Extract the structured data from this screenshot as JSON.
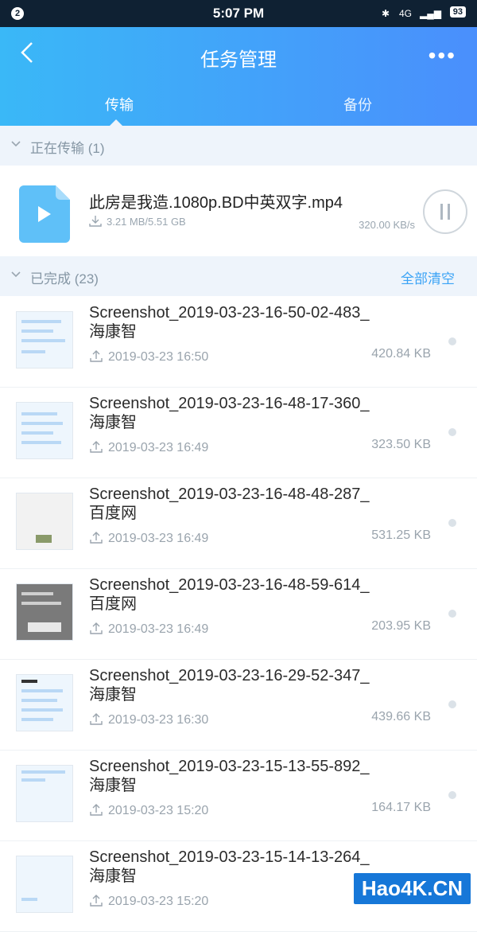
{
  "status": {
    "badge": "2",
    "time": "5:07 PM",
    "network": "4G",
    "battery": "93"
  },
  "header": {
    "title": "任务管理",
    "more_label": "•••"
  },
  "tabs": [
    {
      "label": "传输",
      "active": true
    },
    {
      "label": "备份",
      "active": false
    }
  ],
  "in_progress": {
    "label": "正在传输 (1)",
    "item": {
      "name": "此房是我造.1080p.BD中英双字.mp4",
      "progress": "3.21 MB/5.51 GB",
      "speed": "320.00 KB/s"
    }
  },
  "completed": {
    "label": "已完成 (23)",
    "clear_all": "全部清空",
    "items": [
      {
        "name": "Screenshot_2019-03-23-16-50-02-483_海康智",
        "date": "2019-03-23 16:50",
        "size": "420.84 KB"
      },
      {
        "name": "Screenshot_2019-03-23-16-48-17-360_海康智",
        "date": "2019-03-23 16:49",
        "size": "323.50 KB"
      },
      {
        "name": "Screenshot_2019-03-23-16-48-48-287_百度网",
        "date": "2019-03-23 16:49",
        "size": "531.25 KB"
      },
      {
        "name": "Screenshot_2019-03-23-16-48-59-614_百度网",
        "date": "2019-03-23 16:49",
        "size": "203.95 KB"
      },
      {
        "name": "Screenshot_2019-03-23-16-29-52-347_海康智",
        "date": "2019-03-23 16:30",
        "size": "439.66 KB"
      },
      {
        "name": "Screenshot_2019-03-23-15-13-55-892_海康智",
        "date": "2019-03-23 15:20",
        "size": "164.17 KB"
      },
      {
        "name": "Screenshot_2019-03-23-15-14-13-264_海康智",
        "date": "2019-03-23 15:20",
        "size": ""
      }
    ]
  },
  "watermark": "Hao4K.CN",
  "colors": {
    "header_start": "#3ab8f7",
    "header_end": "#4a8ffc",
    "accent": "#3aa3f6",
    "section_bg": "#eef4fb"
  }
}
